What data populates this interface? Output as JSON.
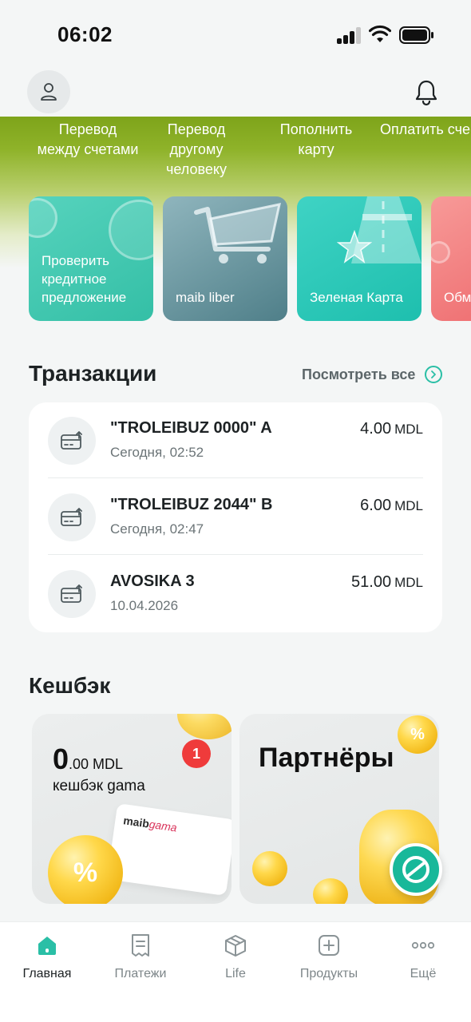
{
  "status": {
    "time": "06:02"
  },
  "quick_actions": [
    {
      "line1": "Перевод",
      "line2": "между счетами",
      "line3": ""
    },
    {
      "line1": "Перевод",
      "line2": "другому",
      "line3": "человеку"
    },
    {
      "line1": "Пополнить",
      "line2": "карту",
      "line3": ""
    },
    {
      "line1": "Оплатить сче",
      "line2": "",
      "line3": ""
    }
  ],
  "promos": [
    {
      "line1": "Проверить",
      "line2": "кредитное",
      "line3": "предложение",
      "color": "#3fc7b0"
    },
    {
      "line1": "maib liber",
      "color": "#5f8e97"
    },
    {
      "line1": "Зеленая Карта",
      "color": "#22c8b8"
    },
    {
      "line1": "Обм",
      "color": "#f0787a"
    }
  ],
  "transactions": {
    "title": "Транзакции",
    "view_all": "Посмотреть все",
    "items": [
      {
        "name": "\"TROLEIBUZ 0000\" A",
        "date": "Сегодня, 02:52",
        "amount": "4.00",
        "currency": "MDL"
      },
      {
        "name": "\"TROLEIBUZ 2044\" B",
        "date": "Сегодня, 02:47",
        "amount": "6.00",
        "currency": "MDL"
      },
      {
        "name": "AVOSIKA 3",
        "date": "10.04.2026",
        "amount": "51.00",
        "currency": "MDL"
      }
    ]
  },
  "cashback": {
    "title": "Кешбэк",
    "amount_big": "0",
    "amount_small": ".00 MDL",
    "subtitle": "кешбэк gama",
    "badge": "1",
    "card_logo_prefix": "maib",
    "card_logo_suffix": "gama",
    "partners_title": "Партнёры"
  },
  "nav": [
    {
      "label": "Главная",
      "icon": "home-icon",
      "active": true
    },
    {
      "label": "Платежи",
      "icon": "receipt-icon",
      "active": false
    },
    {
      "label": "Life",
      "icon": "box-icon",
      "active": false
    },
    {
      "label": "Продукты",
      "icon": "plus-square-icon",
      "active": false
    },
    {
      "label": "Ещё",
      "icon": "more-icon",
      "active": false
    }
  ],
  "colors": {
    "accent": "#2abfa6",
    "badge": "#ef3b3b",
    "band": "#8fb32a"
  }
}
